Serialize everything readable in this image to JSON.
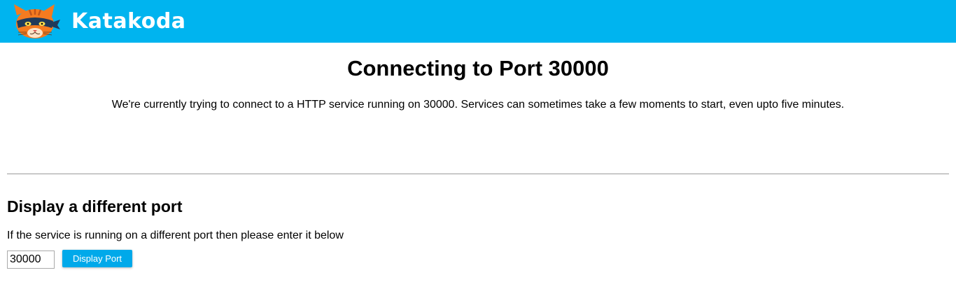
{
  "header": {
    "brand": "Katakoda",
    "logo_icon": "cat-ninja-logo-icon",
    "background_color": "#00b4ef"
  },
  "main": {
    "title": "Connecting to Port 30000",
    "description": "We're currently trying to connect to a HTTP service running on 30000. Services can sometimes take a few moments to start, even upto five minutes."
  },
  "port_section": {
    "title": "Display a different port",
    "description": "If the service is running on a different port then please enter it below",
    "port_value": "30000",
    "button_label": "Display Port",
    "button_color": "#00a9ea"
  }
}
